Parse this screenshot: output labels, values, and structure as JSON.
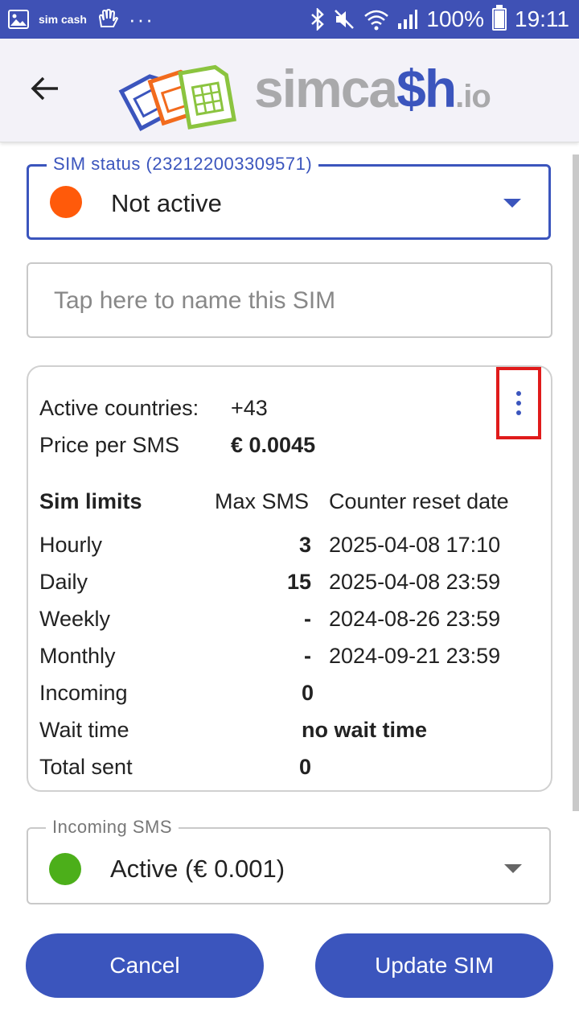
{
  "status_bar": {
    "battery": "100%",
    "time": "19:11",
    "app_icon_text": "sim cash",
    "more": "···"
  },
  "app_bar": {
    "logo_sim": "simca",
    "logo_cash": "$h",
    "logo_io": ".io"
  },
  "sim_status": {
    "label": "SIM status (232122003309571)",
    "value": "Not active",
    "dot_color": "#ff5a0a"
  },
  "sim_name": {
    "placeholder": "Tap here to name this SIM",
    "value": ""
  },
  "info": {
    "active_countries_label": "Active countries:",
    "active_countries_value": "+43",
    "price_label": "Price per SMS",
    "price_value": "€ 0.0045",
    "limits_header": "Sim limits",
    "max_sms_header": "Max SMS",
    "reset_header": "Counter reset date",
    "limits": [
      {
        "name": "Hourly",
        "max": "3",
        "reset": "2025-04-08 17:10"
      },
      {
        "name": "Daily",
        "max": "15",
        "reset": "2025-04-08 23:59"
      },
      {
        "name": "Weekly",
        "max": "-",
        "reset": "2024-08-26 23:59"
      },
      {
        "name": "Monthly",
        "max": "-",
        "reset": "2024-09-21 23:59"
      }
    ],
    "incoming_label": "Incoming",
    "incoming_value": "0",
    "wait_label": "Wait time",
    "wait_value": "no wait time",
    "total_label": "Total sent",
    "total_value": "0"
  },
  "incoming_sms": {
    "label": "Incoming SMS",
    "value": "Active (€ 0.001)",
    "dot_color": "#4caf1a"
  },
  "buttons": {
    "cancel": "Cancel",
    "update": "Update SIM"
  }
}
